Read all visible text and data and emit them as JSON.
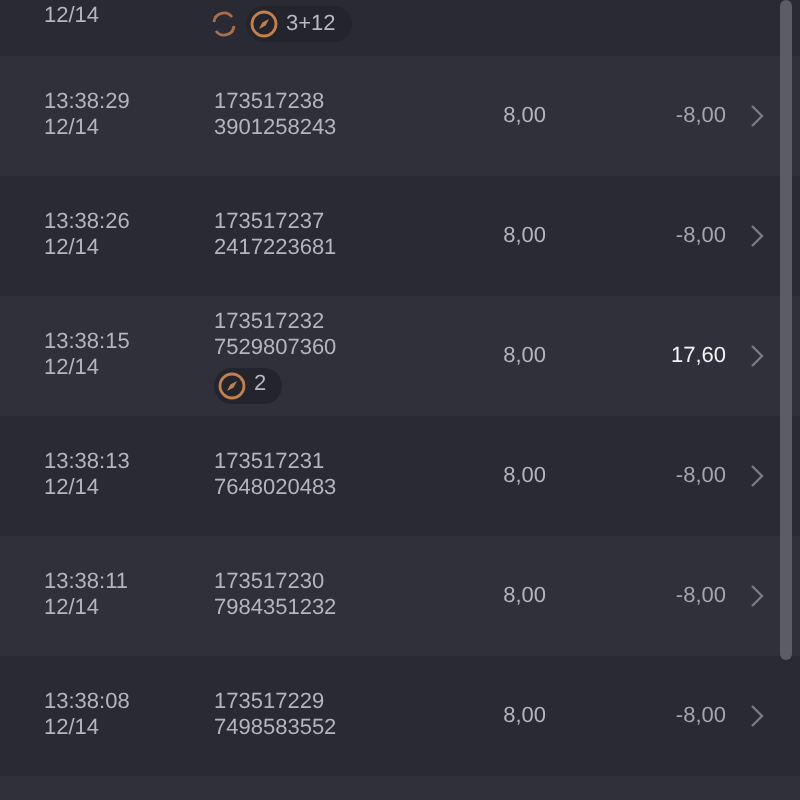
{
  "top_row": {
    "date": "12/14",
    "badges": [
      {
        "kind": "refresh"
      },
      {
        "kind": "pill",
        "count": "3+12"
      }
    ]
  },
  "rows": [
    {
      "time": "13:38:29",
      "date": "12/14",
      "id": "173517238",
      "code": "3901258243",
      "stake": "8,00",
      "result": "-8,00",
      "positive": false,
      "badges": []
    },
    {
      "time": "13:38:26",
      "date": "12/14",
      "id": "173517237",
      "code": "2417223681",
      "stake": "8,00",
      "result": "-8,00",
      "positive": false,
      "badges": []
    },
    {
      "time": "13:38:15",
      "date": "12/14",
      "id": "173517232",
      "code": "7529807360",
      "stake": "8,00",
      "result": "17,60",
      "positive": true,
      "badges": [
        {
          "kind": "pill",
          "count": "2"
        }
      ]
    },
    {
      "time": "13:38:13",
      "date": "12/14",
      "id": "173517231",
      "code": "7648020483",
      "stake": "8,00",
      "result": "-8,00",
      "positive": false,
      "badges": []
    },
    {
      "time": "13:38:11",
      "date": "12/14",
      "id": "173517230",
      "code": "7984351232",
      "stake": "8,00",
      "result": "-8,00",
      "positive": false,
      "badges": []
    },
    {
      "time": "13:38:08",
      "date": "12/14",
      "id": "173517229",
      "code": "7498583552",
      "stake": "8,00",
      "result": "-8,00",
      "positive": false,
      "badges": []
    }
  ]
}
